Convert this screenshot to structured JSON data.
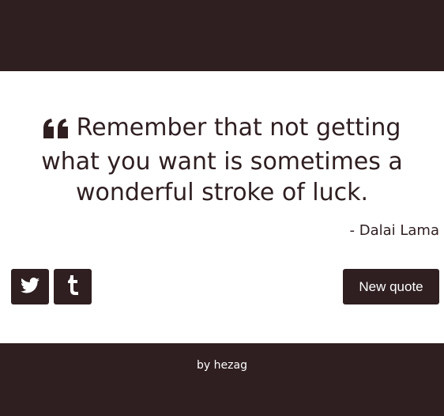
{
  "theme": {
    "background": "#2f1f21",
    "card": "#ffffff",
    "accent": "#2f1f21"
  },
  "quote": {
    "icon": "quote-left-icon",
    "text": "Remember that not getting what you want is sometimes a wonderful stroke of luck.",
    "author": "- Dalai Lama"
  },
  "actions": {
    "twitter_icon": "twitter-icon",
    "tumblr_icon": "tumblr-icon",
    "new_quote_label": "New quote"
  },
  "footer": {
    "prefix": "by",
    "author": "hezag"
  }
}
